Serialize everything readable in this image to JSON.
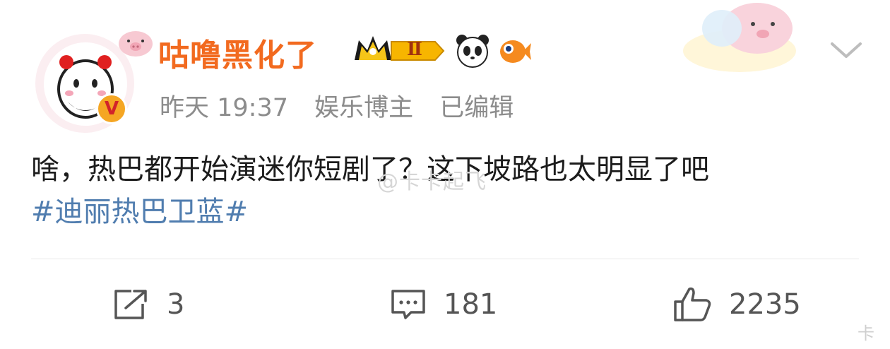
{
  "post": {
    "username": "咕噜黑化了",
    "meta": {
      "time": "昨天 19:37",
      "role": "娱乐博主",
      "edited": "已编辑"
    },
    "content_text": "啥，热巴都开始演迷你短剧了？这下坡路也太明显了吧",
    "topic": "#迪丽热巴卫蓝#",
    "watermark": "@卡卡起飞",
    "verified_badge": "V",
    "level_badge": "Ⅱ"
  },
  "actions": {
    "repost_count": "3",
    "comment_count": "181",
    "like_count": "2235"
  },
  "footer_mark": "卡",
  "icons": {
    "repost": "share-arrow-icon",
    "comment": "comment-bubble-icon",
    "like": "thumb-up-icon",
    "more": "chevron-down-icon"
  },
  "colors": {
    "username": "#f26a1f",
    "topic": "#507daf",
    "meta": "#8c8c8c",
    "badge_gold": "#f5a623"
  }
}
